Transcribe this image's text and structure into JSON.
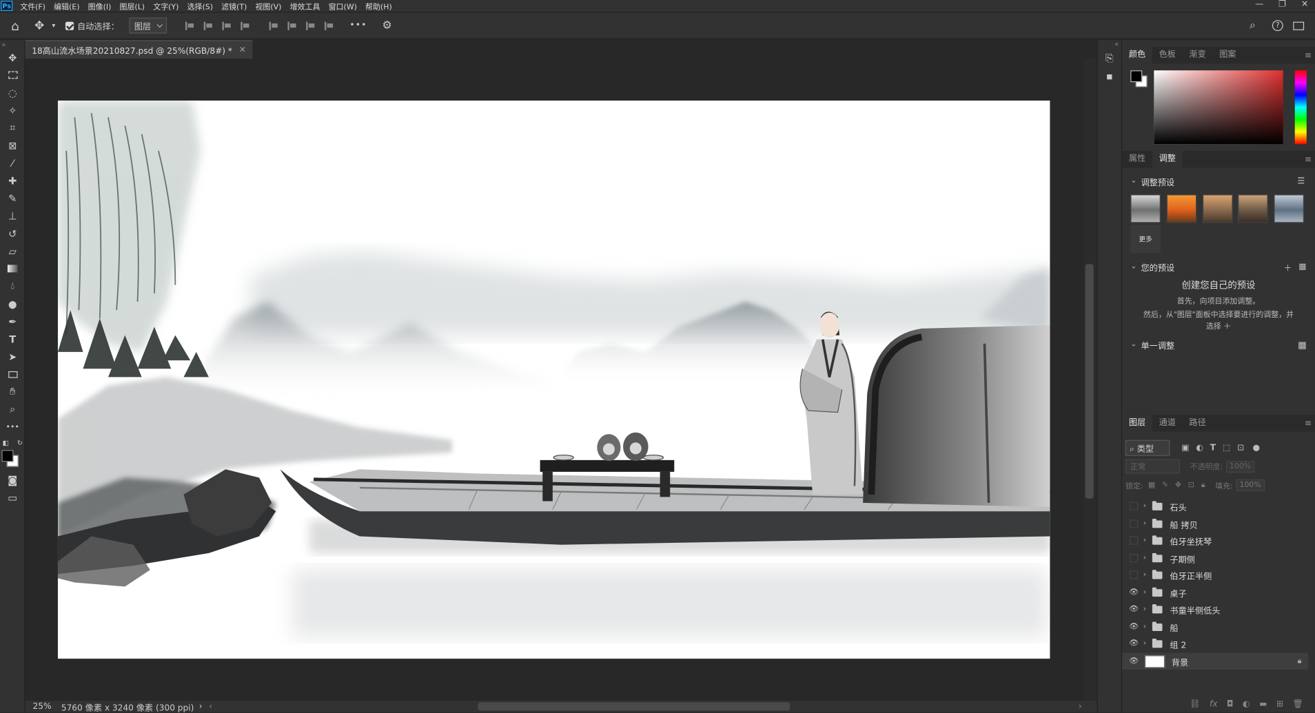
{
  "app": {
    "badge": "Ps"
  },
  "menu": [
    "文件(F)",
    "编辑(E)",
    "图像(I)",
    "图层(L)",
    "文字(Y)",
    "选择(S)",
    "滤镜(T)",
    "视图(V)",
    "增效工具",
    "窗口(W)",
    "帮助(H)"
  ],
  "window_controls": {
    "minimize": "—",
    "restore": "❐",
    "close": "✕"
  },
  "options": {
    "auto_select_label": "自动选择：",
    "auto_select_checked": true,
    "target_select": "图层",
    "more": "•••"
  },
  "document": {
    "tab_title": "18高山流水场景20210827.psd @ 25%(RGB/8#) *",
    "close": "×"
  },
  "status": {
    "zoom": "25%",
    "info": "5760 像素 x 3240 像素 (300 ppi)",
    "arrow": "›",
    "left_arrow": "‹",
    "right_arrow": "›"
  },
  "color_panel": {
    "tabs": [
      "颜色",
      "色板",
      "渐变",
      "图案"
    ],
    "active_tab": 0,
    "foreground": "#000000",
    "background": "#ffffff",
    "hue_color": "#e03030"
  },
  "adjust_panel": {
    "tabs": [
      "属性",
      "调整"
    ],
    "active_tab": 1,
    "presets_section": "调整预设",
    "more_label": "更多",
    "your_presets_section": "您的预设",
    "create_title": "创建您自己的预设",
    "create_line1": "首先，向项目添加调整。",
    "create_line2": "然后，从\"图层\"面板中选择要进行的调整，并",
    "create_line3": "选择 ＋",
    "single_section": "单一调整"
  },
  "layers_panel": {
    "tabs": [
      "图层",
      "通道",
      "路径"
    ],
    "active_tab": 0,
    "filter_label": "类型",
    "blend_mode": "正常",
    "opacity_label": "不透明度:",
    "opacity_value": "100%",
    "lock_label": "锁定:",
    "fill_label": "填充:",
    "fill_value": "100%",
    "layers": [
      {
        "name": "石头",
        "visible": false,
        "type": "group"
      },
      {
        "name": "船 拷贝",
        "visible": false,
        "type": "group"
      },
      {
        "name": "伯牙坐抚琴",
        "visible": false,
        "type": "group"
      },
      {
        "name": "子期侧",
        "visible": false,
        "type": "group"
      },
      {
        "name": "伯牙正半侧",
        "visible": false,
        "type": "group"
      },
      {
        "name": "桌子",
        "visible": true,
        "type": "group"
      },
      {
        "name": "书童半侧低头",
        "visible": true,
        "type": "group"
      },
      {
        "name": "船",
        "visible": true,
        "type": "group"
      },
      {
        "name": "组 2",
        "visible": true,
        "type": "group"
      },
      {
        "name": "背景",
        "visible": true,
        "type": "layer",
        "locked": true
      }
    ]
  }
}
